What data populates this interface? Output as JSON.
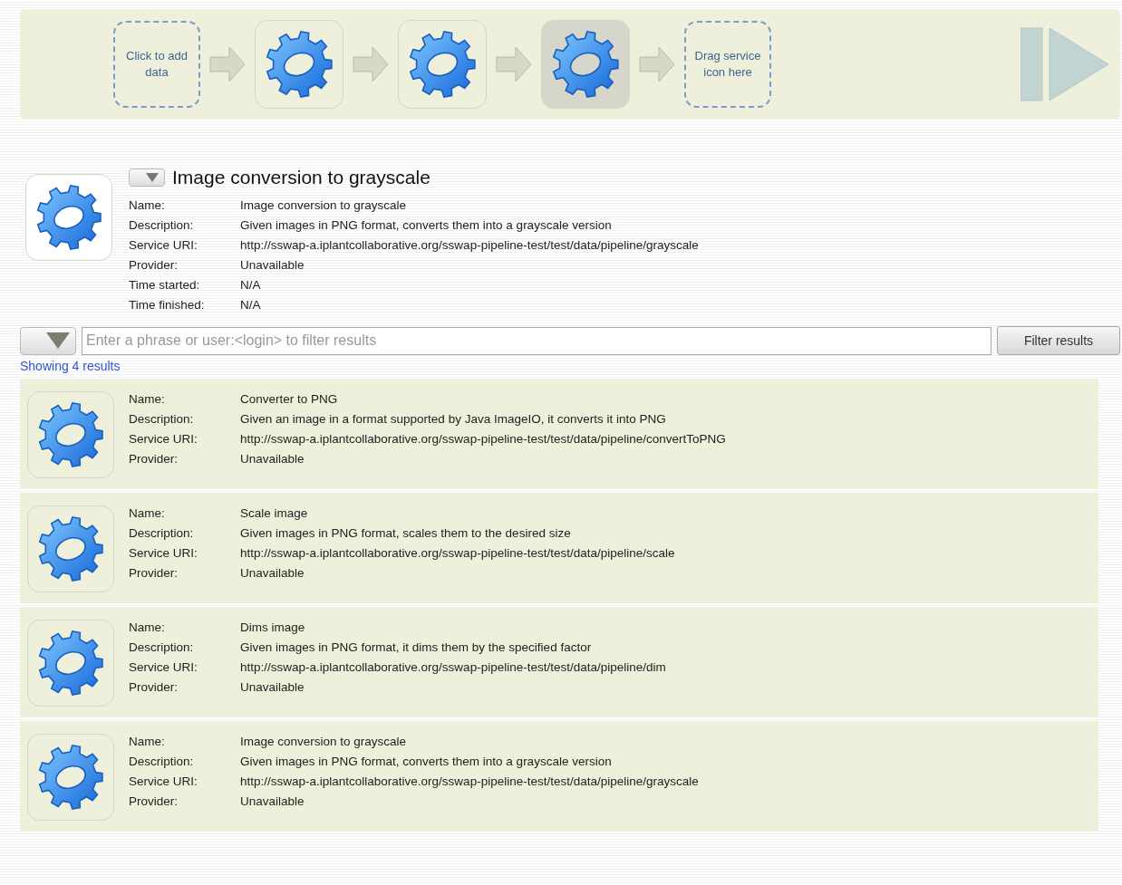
{
  "pipeline": {
    "steps": [
      {
        "kind": "placeholder",
        "text": "Click to add data"
      },
      {
        "kind": "service",
        "selected": false
      },
      {
        "kind": "service",
        "selected": false
      },
      {
        "kind": "service",
        "selected": true
      },
      {
        "kind": "placeholder",
        "text": "Drag service icon here"
      }
    ]
  },
  "details": {
    "title": "Image conversion to grayscale",
    "fields": [
      {
        "label": "Name:",
        "value": "Image conversion to grayscale"
      },
      {
        "label": "Description:",
        "value": "Given images in PNG format, converts them into a grayscale version"
      },
      {
        "label": "Service URI:",
        "value": "http://sswap-a.iplantcollaborative.org/sswap-pipeline-test/test/data/pipeline/grayscale"
      },
      {
        "label": "Provider:",
        "value": "Unavailable"
      },
      {
        "label": "Time started:",
        "value": "N/A"
      },
      {
        "label": "Time finished:",
        "value": "N/A"
      }
    ]
  },
  "filter": {
    "placeholder": "Enter a phrase or user:<login> to filter results",
    "button": "Filter results",
    "count": "Showing 4 results"
  },
  "results": [
    {
      "fields": [
        {
          "label": "Name:",
          "value": "Converter to PNG"
        },
        {
          "label": "Description:",
          "value": "Given an image in a format supported by Java ImageIO, it converts it into PNG"
        },
        {
          "label": "Service URI:",
          "value": "http://sswap-a.iplantcollaborative.org/sswap-pipeline-test/test/data/pipeline/convertToPNG"
        },
        {
          "label": "Provider:",
          "value": "Unavailable"
        }
      ]
    },
    {
      "fields": [
        {
          "label": "Name:",
          "value": "Scale image"
        },
        {
          "label": "Description:",
          "value": "Given images in PNG format, scales them to the desired size"
        },
        {
          "label": "Service URI:",
          "value": "http://sswap-a.iplantcollaborative.org/sswap-pipeline-test/test/data/pipeline/scale"
        },
        {
          "label": "Provider:",
          "value": "Unavailable"
        }
      ]
    },
    {
      "fields": [
        {
          "label": "Name:",
          "value": "Dims image"
        },
        {
          "label": "Description:",
          "value": "Given images in PNG format, it dims them by the specified factor"
        },
        {
          "label": "Service URI:",
          "value": "http://sswap-a.iplantcollaborative.org/sswap-pipeline-test/test/data/pipeline/dim"
        },
        {
          "label": "Provider:",
          "value": "Unavailable"
        }
      ]
    },
    {
      "fields": [
        {
          "label": "Name:",
          "value": "Image conversion to grayscale"
        },
        {
          "label": "Description:",
          "value": "Given images in PNG format, converts them into a grayscale version"
        },
        {
          "label": "Service URI:",
          "value": "http://sswap-a.iplantcollaborative.org/sswap-pipeline-test/test/data/pipeline/grayscale"
        },
        {
          "label": "Provider:",
          "value": "Unavailable"
        }
      ]
    }
  ]
}
